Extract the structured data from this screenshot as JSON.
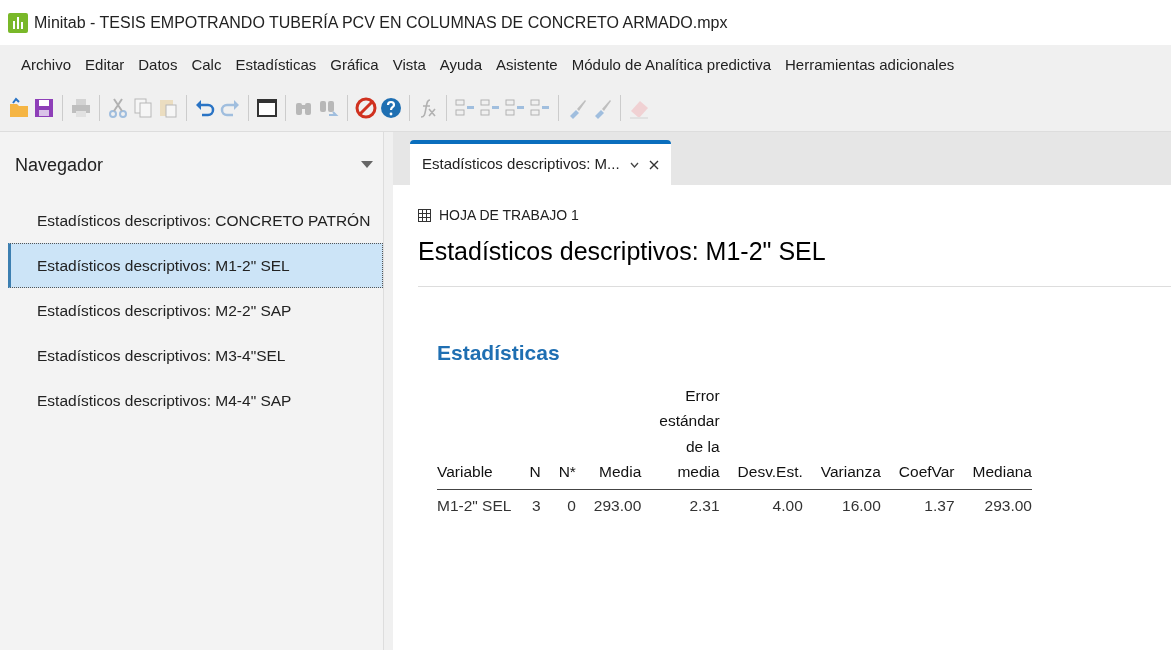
{
  "window": {
    "title": "Minitab - TESIS EMPOTRANDO TUBERÍA PCV EN COLUMNAS DE CONCRETO ARMADO.mpx"
  },
  "menu": [
    "Archivo",
    "Editar",
    "Datos",
    "Calc",
    "Estadísticas",
    "Gráfica",
    "Vista",
    "Ayuda",
    "Asistente",
    "Módulo de Analítica predictiva",
    "Herramientas adicionales"
  ],
  "toolbar": [
    {
      "kind": "open",
      "disabled": false
    },
    {
      "kind": "save",
      "disabled": false
    },
    {
      "kind": "separator"
    },
    {
      "kind": "print",
      "disabled": true
    },
    {
      "kind": "separator"
    },
    {
      "kind": "cut",
      "disabled": true
    },
    {
      "kind": "copy",
      "disabled": true
    },
    {
      "kind": "paste",
      "disabled": true
    },
    {
      "kind": "separator"
    },
    {
      "kind": "undo",
      "disabled": false
    },
    {
      "kind": "redo",
      "disabled": true
    },
    {
      "kind": "separator"
    },
    {
      "kind": "window",
      "disabled": false
    },
    {
      "kind": "separator"
    },
    {
      "kind": "find",
      "disabled": true
    },
    {
      "kind": "replace",
      "disabled": true
    },
    {
      "kind": "separator"
    },
    {
      "kind": "stop",
      "disabled": false
    },
    {
      "kind": "help",
      "disabled": false
    },
    {
      "kind": "separator"
    },
    {
      "kind": "fx",
      "disabled": true
    },
    {
      "kind": "separator"
    },
    {
      "kind": "layout",
      "disabled": true
    },
    {
      "kind": "layout",
      "disabled": true
    },
    {
      "kind": "layout",
      "disabled": true
    },
    {
      "kind": "layout",
      "disabled": true
    },
    {
      "kind": "separator"
    },
    {
      "kind": "brush",
      "disabled": true
    },
    {
      "kind": "brush",
      "disabled": true
    },
    {
      "kind": "separator"
    },
    {
      "kind": "eraser",
      "disabled": true
    }
  ],
  "navigator": {
    "title": "Navegador",
    "items": [
      {
        "label": "Estadísticos descriptivos: CONCRETO PATRÓN",
        "selected": false
      },
      {
        "label": "Estadísticos descriptivos: M1-2\" SEL",
        "selected": true
      },
      {
        "label": "Estadísticos descriptivos: M2-2\" SAP",
        "selected": false
      },
      {
        "label": "Estadísticos descriptivos: M3-4\"SEL",
        "selected": false
      },
      {
        "label": "Estadísticos descriptivos: M4-4\" SAP",
        "selected": false
      }
    ]
  },
  "tabs": [
    {
      "label": "Estadísticos descriptivos: M...",
      "selected": true
    }
  ],
  "output": {
    "worksheet": "HOJA DE TRABAJO 1",
    "title": "Estadísticos descriptivos: M1-2\" SEL",
    "section": "Estadísticas",
    "table": {
      "columns": [
        "Variable",
        "N",
        "N*",
        "Media",
        "Error estándar de la media",
        "Desv.Est.",
        "Varianza",
        "CoefVar",
        "Mediana"
      ],
      "rows": [
        [
          "M1-2\" SEL",
          "3",
          "0",
          "293.00",
          "2.31",
          "4.00",
          "16.00",
          "1.37",
          "293.00"
        ]
      ]
    }
  }
}
